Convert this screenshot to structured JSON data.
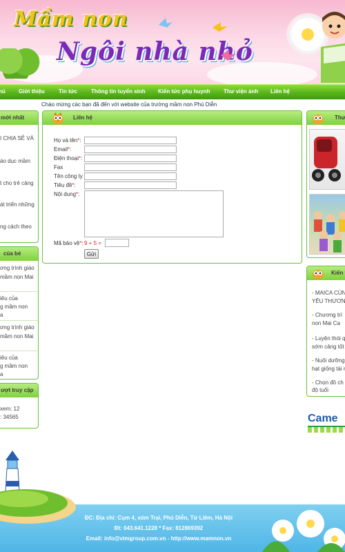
{
  "header": {
    "logo_line1": "Mầm non",
    "logo_line2": "Ngôi nhà nhỏ"
  },
  "nav": {
    "items": [
      {
        "label": "hủ"
      },
      {
        "label": "Giới thiệu"
      },
      {
        "label": "Tin tức"
      },
      {
        "label": "Thông tin tuyển sinh"
      },
      {
        "label": "Kiến tức phụ huynh"
      },
      {
        "label": "Thư viện ảnh"
      },
      {
        "label": "Liên hệ"
      }
    ]
  },
  "welcome": "Chào mừng các bạn đã đến với website của trường mầm non Phú Diễn",
  "left_col": {
    "news_title": "mới nhất",
    "news_items": [
      "I CHIA SẺ VÀ",
      "áo dục mầm",
      "t cho trẻ cảng",
      "át triển những",
      "ng cách theo"
    ],
    "kids_title": "của bé",
    "kids_items": [
      [
        "ơng trình giáo",
        "mầm non Mai"
      ],
      [
        "iêu của",
        "g mầm non",
        "a"
      ],
      [
        "ơng trình giáo",
        "mầm non Mai"
      ],
      [
        "iêu của",
        "g mầm non",
        "a"
      ]
    ],
    "stats_title": "ượt truy cập",
    "stats_lines": [
      "xem: 12",
      ": 34565"
    ]
  },
  "contact": {
    "title": "Liên hệ",
    "fields": [
      {
        "label": "Họ và tên",
        "required": true,
        "value": ""
      },
      {
        "label": "Email",
        "required": true,
        "value": ""
      },
      {
        "label": "Điện thoại",
        "required": true,
        "value": ""
      },
      {
        "label": "Fax",
        "required": false,
        "value": ""
      },
      {
        "label": "Tên công ty",
        "required": false,
        "value": ""
      },
      {
        "label": "Tiêu đề",
        "required": true,
        "value": ""
      }
    ],
    "content_label": "Nội dung",
    "captcha_label": "Mã bảo vệ",
    "captcha_question": "9 + 5 =",
    "captcha_value": "",
    "submit_label": "Gửi",
    "required_mark": "*",
    "colon": ":"
  },
  "right_col": {
    "gallery_title": "Thư",
    "knowledge_title": "Kiến t",
    "knowledge_items": [
      [
        "- MAICA CÙN",
        "YÊU THƯƠN"
      ],
      [
        "- Chương trì",
        "non Mai Ca"
      ],
      [
        "- Luyện thói q",
        "sớm cảng tốt"
      ],
      [
        "- Nuôi dưỡng",
        "hạt giống tài n"
      ],
      [
        "- Chọn đồ ch",
        "độ tuổi"
      ]
    ],
    "ad_text": "Came"
  },
  "footer": {
    "address": "ĐC: Địa chỉ: Cụm 4, xóm Trại, Phú Diễn, Từ Liêm, Hà Nội",
    "phone": "Đt: 043.641.1228 * Fax: 812869392",
    "email": "Email: info@vtmgroup.com.vn - http://www.mamnon.vn"
  },
  "colors": {
    "nav_green": "#58b51a",
    "box_border": "#67c13a",
    "required_red": "#d22222",
    "footer_blue": "#4fb6e6"
  }
}
